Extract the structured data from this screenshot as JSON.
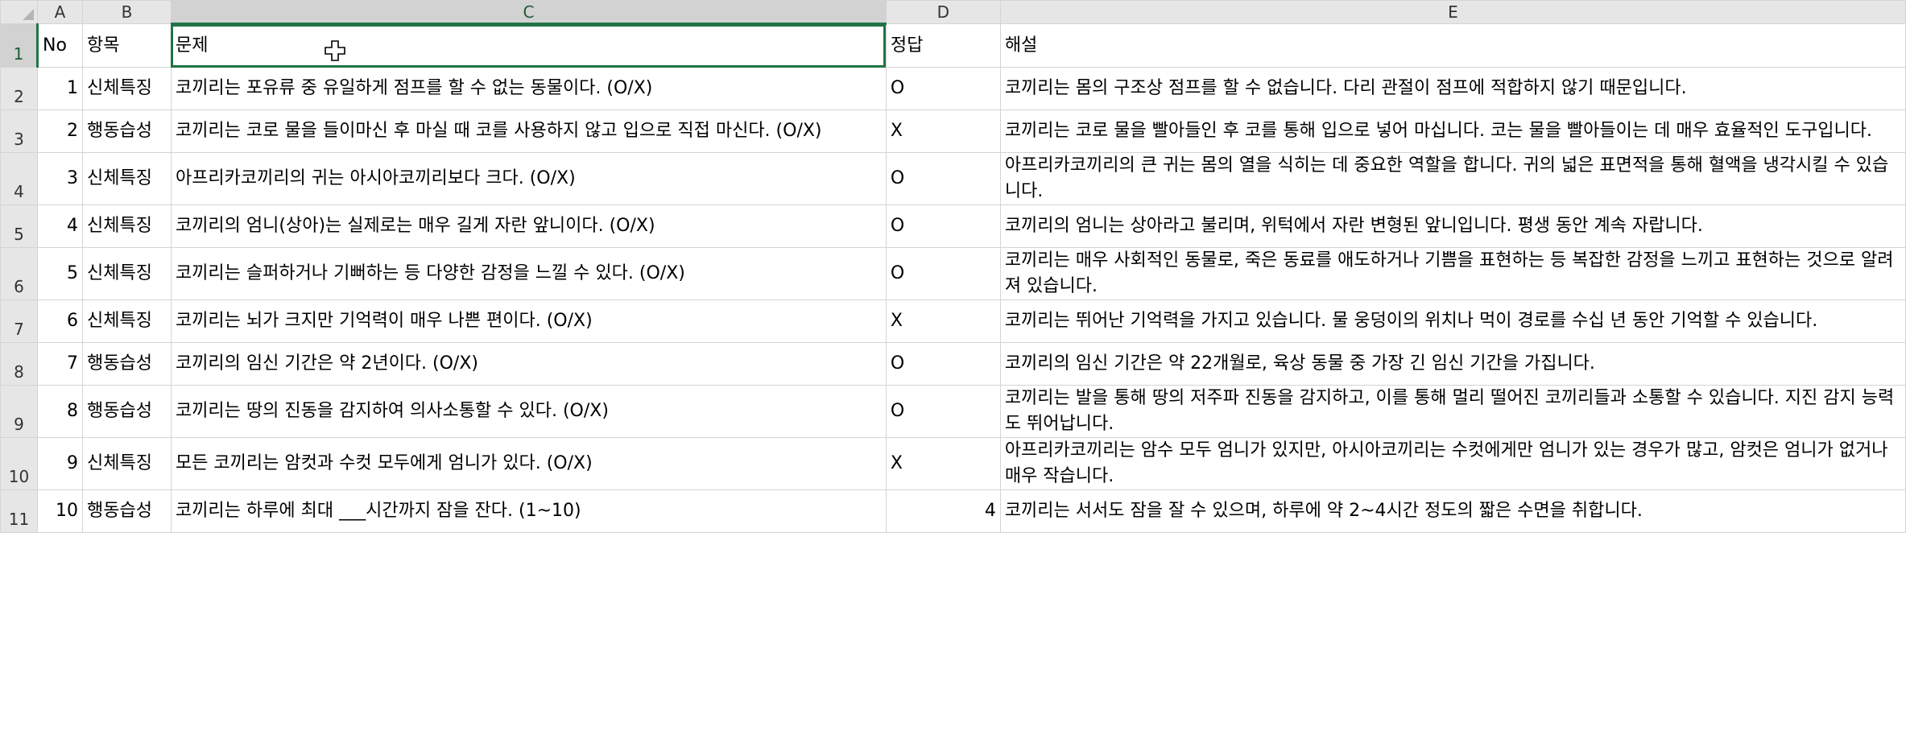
{
  "columns": [
    "A",
    "B",
    "C",
    "D",
    "E"
  ],
  "headers": {
    "no": "No",
    "item": "항목",
    "question": "문제",
    "answer": "정답",
    "explanation": "해설"
  },
  "rows": [
    {
      "row": "2",
      "no": "1",
      "item": "신체특징",
      "question": "코끼리는 포유류 중 유일하게 점프를 할 수 없는 동물이다. (O/X)",
      "answer": "O",
      "explanation": "코끼리는 몸의 구조상 점프를 할 수 없습니다. 다리 관절이 점프에 적합하지 않기 때문입니다."
    },
    {
      "row": "3",
      "no": "2",
      "item": "행동습성",
      "question": "코끼리는 코로 물을 들이마신 후 마실 때 코를 사용하지 않고 입으로 직접 마신다. (O/X)",
      "answer": "X",
      "explanation": "코끼리는 코로 물을 빨아들인 후 코를 통해 입으로 넣어 마십니다. 코는 물을 빨아들이는 데 매우 효율적인 도구입니다."
    },
    {
      "row": "4",
      "no": "3",
      "item": "신체특징",
      "question": "아프리카코끼리의 귀는 아시아코끼리보다 크다. (O/X)",
      "answer": "O",
      "explanation": "아프리카코끼리의 큰 귀는 몸의 열을 식히는 데 중요한 역할을 합니다. 귀의 넓은 표면적을 통해 혈액을 냉각시킬 수 있습니다."
    },
    {
      "row": "5",
      "no": "4",
      "item": "신체특징",
      "question": "코끼리의 엄니(상아)는 실제로는 매우 길게 자란 앞니이다. (O/X)",
      "answer": "O",
      "explanation": "코끼리의 엄니는 상아라고 불리며, 위턱에서 자란 변형된 앞니입니다. 평생 동안 계속 자랍니다."
    },
    {
      "row": "6",
      "no": "5",
      "item": "신체특징",
      "question": "코끼리는 슬퍼하거나 기뻐하는 등 다양한 감정을 느낄 수 있다. (O/X)",
      "answer": "O",
      "explanation": "코끼리는 매우 사회적인 동물로, 죽은 동료를 애도하거나 기쁨을 표현하는 등 복잡한 감정을 느끼고 표현하는 것으로 알려져 있습니다."
    },
    {
      "row": "7",
      "no": "6",
      "item": "신체특징",
      "question": "코끼리는 뇌가 크지만 기억력이 매우 나쁜 편이다. (O/X)",
      "answer": "X",
      "explanation": "코끼리는 뛰어난 기억력을 가지고 있습니다. 물 웅덩이의 위치나 먹이 경로를 수십 년 동안 기억할 수 있습니다."
    },
    {
      "row": "8",
      "no": "7",
      "item": "행동습성",
      "question": "코끼리의 임신 기간은 약 2년이다. (O/X)",
      "answer": "O",
      "explanation": "코끼리의 임신 기간은 약 22개월로, 육상 동물 중 가장 긴 임신 기간을 가집니다."
    },
    {
      "row": "9",
      "no": "8",
      "item": "행동습성",
      "question": "코끼리는 땅의 진동을 감지하여 의사소통할 수 있다. (O/X)",
      "answer": "O",
      "explanation": "코끼리는 발을 통해 땅의 저주파 진동을 감지하고, 이를 통해 멀리 떨어진 코끼리들과 소통할 수 있습니다. 지진 감지 능력도 뛰어납니다."
    },
    {
      "row": "10",
      "no": "9",
      "item": "신체특징",
      "question": "모든 코끼리는 암컷과 수컷 모두에게 엄니가 있다. (O/X)",
      "answer": "X",
      "explanation": "아프리카코끼리는 암수 모두 엄니가 있지만, 아시아코끼리는 수컷에게만 엄니가 있는 경우가 많고, 암컷은 엄니가 없거나 매우 작습니다."
    },
    {
      "row": "11",
      "no": "10",
      "item": "행동습성",
      "question": "코끼리는 하루에 최대 ___시간까지 잠을 잔다. (1~10)",
      "answer": "4",
      "explanation": "코끼리는 서서도 잠을 잘 수 있으며, 하루에 약 2~4시간 정도의 짧은 수면을 취합니다."
    }
  ],
  "row1_label": "1",
  "colors": {
    "selection": "#217346",
    "header_bg": "#e6e6e6",
    "selected_header_bg": "#d2d2d2",
    "gridline": "#d4d4d4"
  }
}
